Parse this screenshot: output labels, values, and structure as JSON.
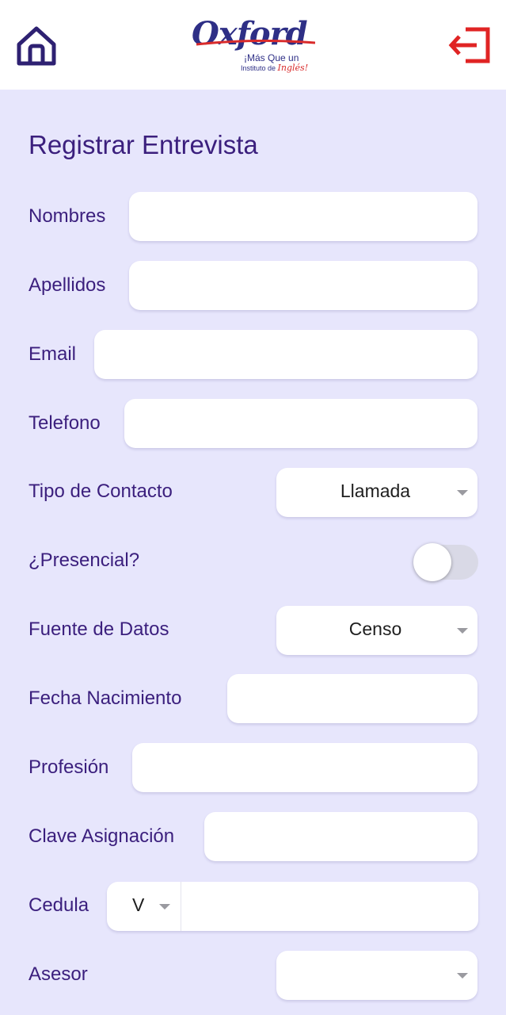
{
  "header": {
    "home_icon": "home-icon",
    "logout_icon": "logout-icon",
    "logo": {
      "word": "Oxford",
      "tagline_1": "¡Más Que un",
      "tagline_2": "Instituto de",
      "tagline_red": "Inglés!"
    },
    "colors": {
      "brand_blue": "#2e2f86",
      "brand_red": "#d92b2b"
    }
  },
  "form": {
    "title": "Registrar Entrevista",
    "nombres_label": "Nombres",
    "nombres_value": "",
    "apellidos_label": "Apellidos",
    "apellidos_value": "",
    "email_label": "Email",
    "email_value": "",
    "telefono_label": "Telefono",
    "telefono_value": "",
    "tipo_contacto_label": "Tipo de Contacto",
    "tipo_contacto_value": "Llamada",
    "presencial_label": "¿Presencial?",
    "presencial_on": false,
    "fuente_datos_label": "Fuente de Datos",
    "fuente_datos_value": "Censo",
    "fecha_nacimiento_label": "Fecha Nacimiento",
    "fecha_nacimiento_value": "",
    "profesion_label": "Profesión",
    "profesion_value": "",
    "clave_asignacion_label": "Clave Asignación",
    "clave_asignacion_value": "",
    "cedula_label": "Cedula",
    "cedula_prefix": "V",
    "cedula_value": "",
    "asesor_label": "Asesor",
    "asesor_value": ""
  },
  "colors": {
    "background": "#e7e6fc",
    "label": "#3b1f7d",
    "field": "#ffffff"
  }
}
